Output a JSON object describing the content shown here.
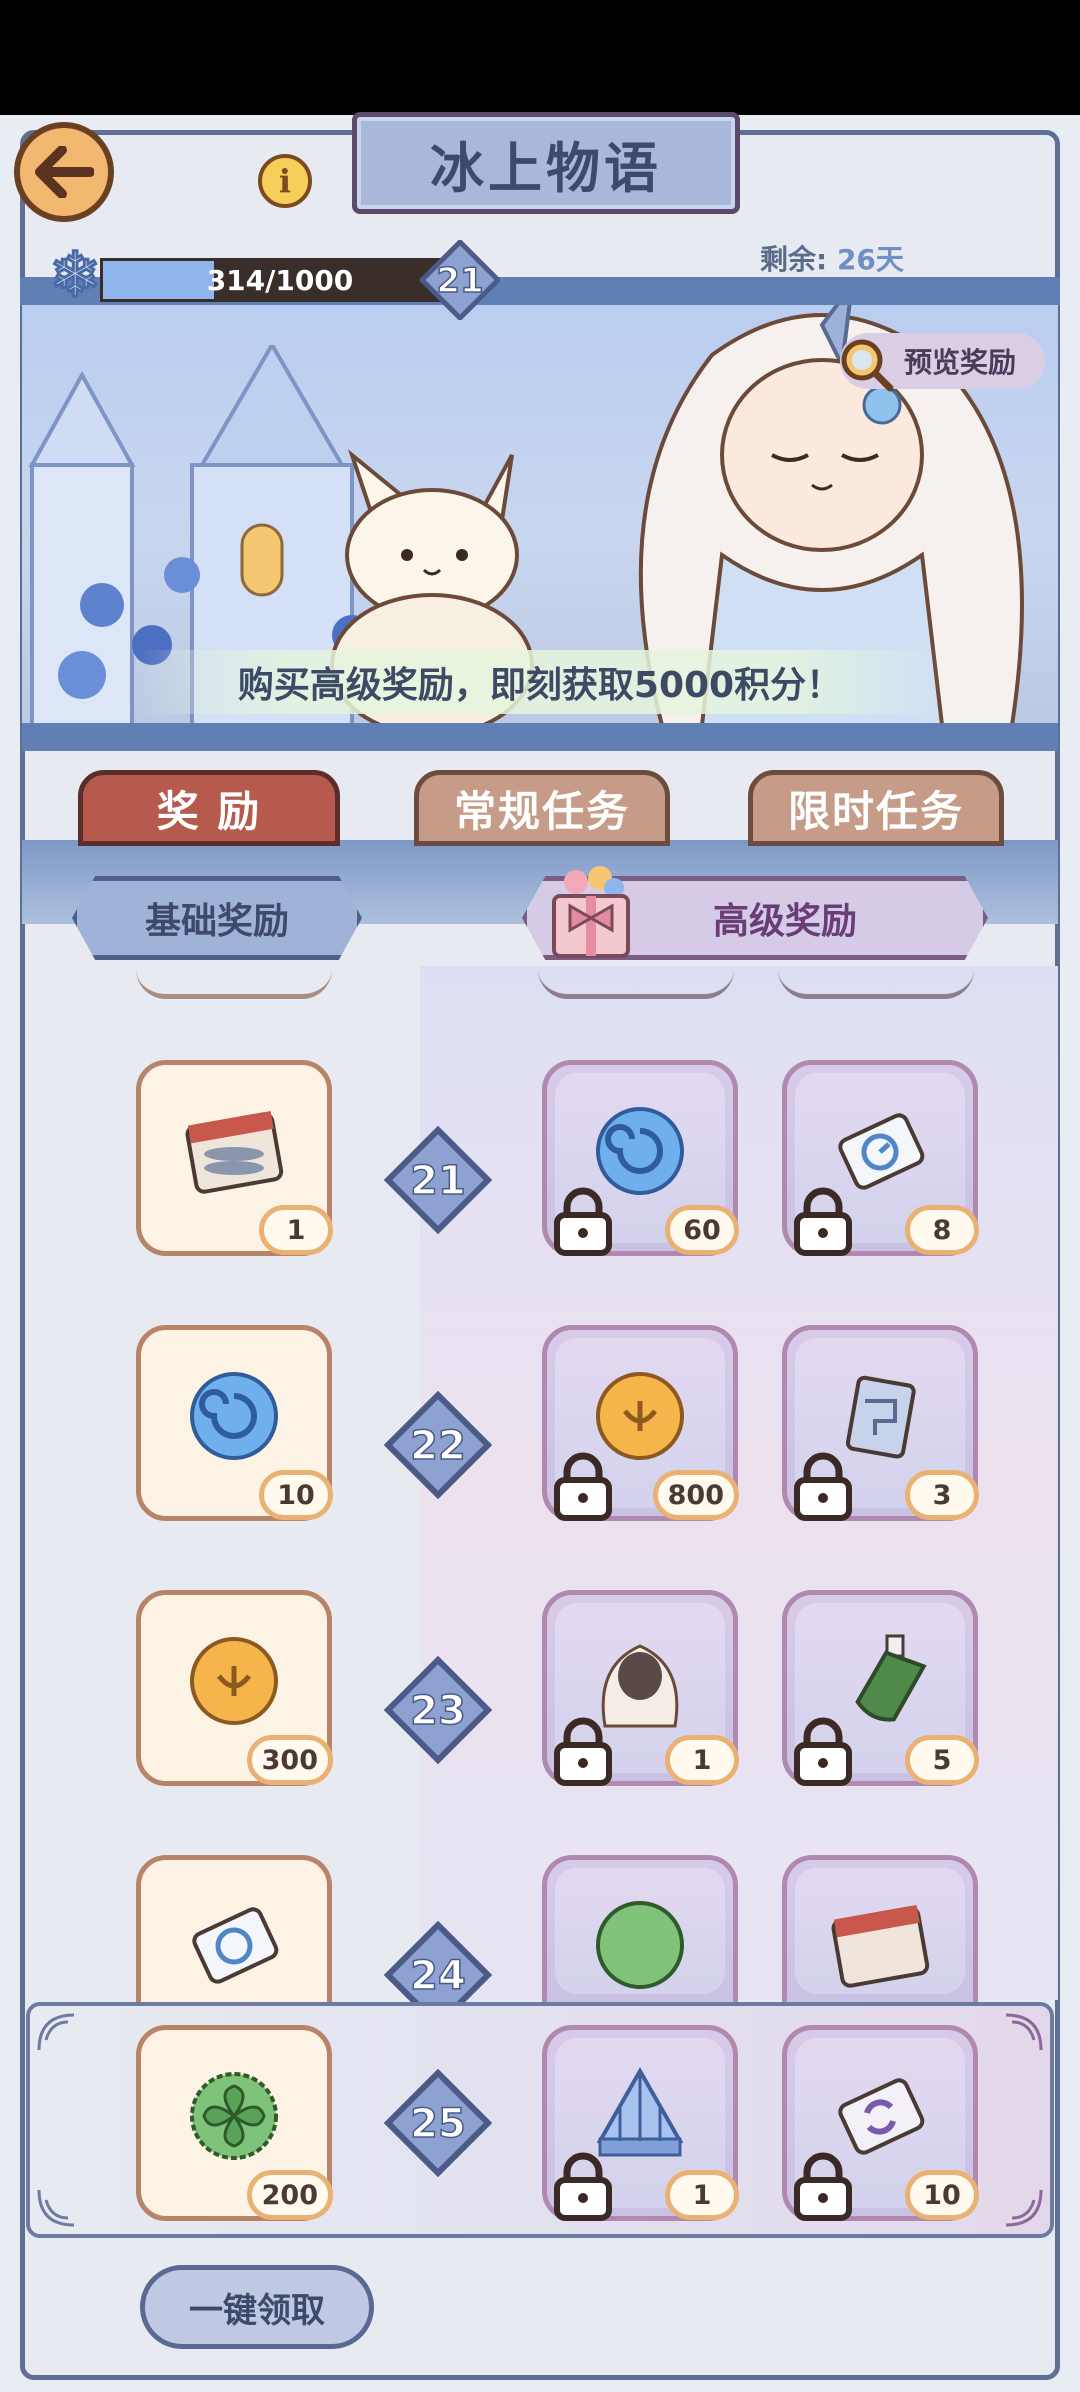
{
  "header": {
    "title": "冰上物语",
    "remain_label": "剩余:",
    "remain_value": "26天",
    "progress_text": "314/1000",
    "progress_fraction": 0.314,
    "current_level": "21"
  },
  "banner": {
    "preview_label": "预览奖励",
    "promo_text": "购买高级奖励，即刻获取5000积分！"
  },
  "tabs": [
    {
      "label": "奖 励"
    },
    {
      "label": "常规任务"
    },
    {
      "label": "限时任务"
    }
  ],
  "sections": {
    "basic": "基础奖励",
    "premium": "高级奖励"
  },
  "rows": [
    {
      "level": "21",
      "basic_qty": "1",
      "p1_qty": "60",
      "p2_qty": "8"
    },
    {
      "level": "22",
      "basic_qty": "10",
      "p1_qty": "800",
      "p2_qty": "3"
    },
    {
      "level": "23",
      "basic_qty": "300",
      "p1_qty": "1",
      "p2_qty": "5"
    },
    {
      "level": "24"
    },
    {
      "level": "25",
      "basic_qty": "200",
      "p1_qty": "1",
      "p2_qty": "10"
    }
  ],
  "footer": {
    "claim_all": "一键领取"
  },
  "colors": {
    "accent_blue": "#5f7fb5",
    "tab_active": "#b65a4d",
    "tab_inactive": "#c69b87"
  }
}
